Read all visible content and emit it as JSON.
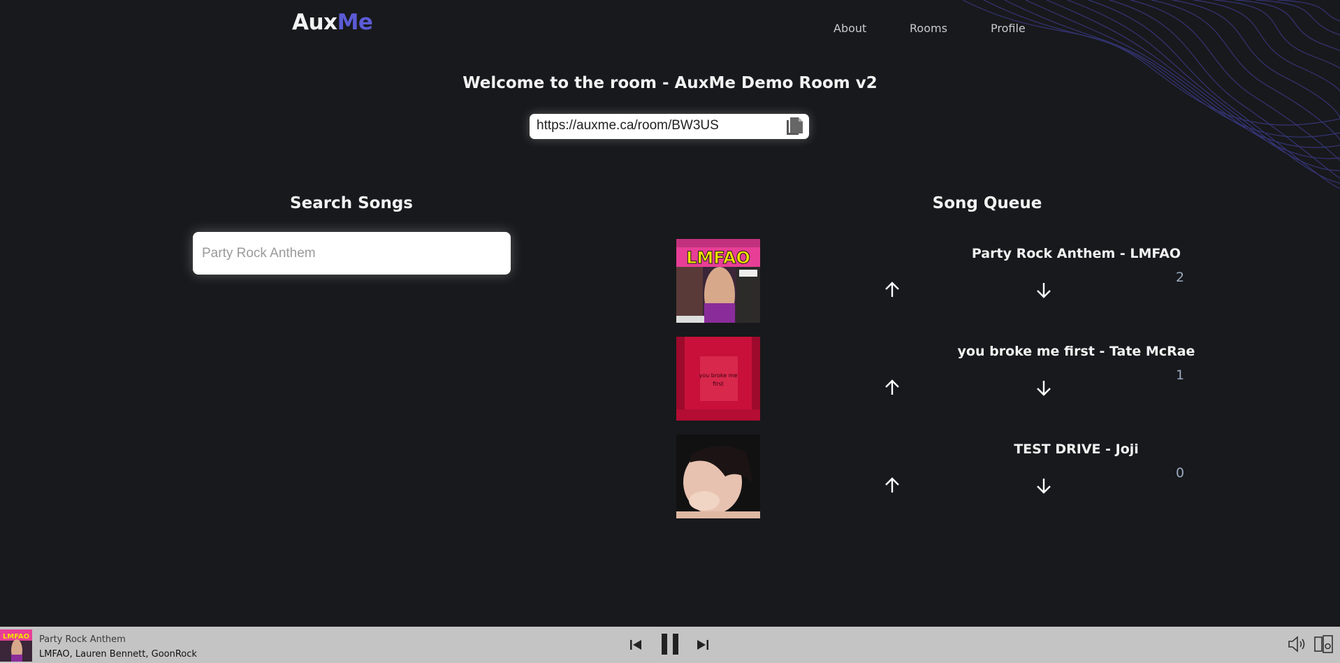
{
  "header": {
    "logo_part1": "Aux",
    "logo_part2": "Me",
    "nav": [
      "About",
      "Rooms",
      "Profile"
    ]
  },
  "room": {
    "title": "Welcome to the room - AuxMe Demo Room v2",
    "url": "https://auxme.ca/room/BW3US",
    "copy_icon": "copy-icon"
  },
  "search": {
    "title": "Search Songs",
    "placeholder": "Party Rock Anthem"
  },
  "queue": {
    "title": "Song Queue",
    "items": [
      {
        "title": "Party Rock Anthem - LMFAO",
        "votes": "2",
        "upvote_icon": "arrow-up-icon",
        "downvote_icon": "arrow-down-icon"
      },
      {
        "title": "you broke me first - Tate McRae",
        "votes": "1",
        "upvote_icon": "arrow-up-icon",
        "downvote_icon": "arrow-down-icon"
      },
      {
        "title": "TEST DRIVE - Joji",
        "votes": "0",
        "upvote_icon": "arrow-up-icon",
        "downvote_icon": "arrow-down-icon"
      }
    ]
  },
  "player": {
    "track": "Party Rock Anthem",
    "artists": "LMFAO, Lauren Bennett, GoonRock",
    "icons": [
      "previous-icon",
      "pause-icon",
      "next-icon",
      "volume-icon",
      "devices-icon"
    ]
  },
  "colors": {
    "background": "#18191c",
    "accent": "#5b5bd6",
    "player_bar": "#c4c4c4",
    "vote_count": "#9aa9bf"
  }
}
